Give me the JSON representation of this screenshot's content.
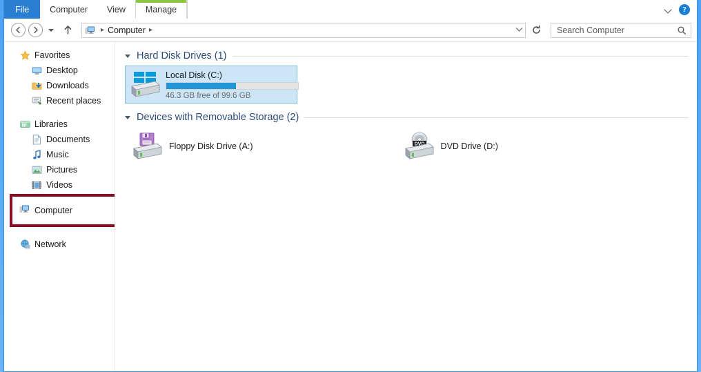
{
  "window": {
    "tabs": [
      {
        "label": "File",
        "kind": "file",
        "active": false
      },
      {
        "label": "Computer",
        "kind": "normal",
        "active": false
      },
      {
        "label": "View",
        "kind": "normal",
        "active": false
      },
      {
        "label": "Manage",
        "kind": "contextual",
        "active": true
      }
    ],
    "ribbon_collapse_icon": "chevron-down-icon",
    "help_icon": "help-icon",
    "help_label": "?"
  },
  "navbar": {
    "back_icon": "back-arrow-icon",
    "forward_icon": "forward-arrow-icon",
    "recent_icon": "recent-locations-icon",
    "up_icon": "up-arrow-icon",
    "breadcrumb_icon": "computer-icon",
    "breadcrumb": [
      "Computer"
    ],
    "separator": "▸",
    "address_dropdown_icon": "chevron-down-icon",
    "refresh_icon": "refresh-icon",
    "search_placeholder": "Search Computer",
    "search_value": "",
    "search_icon": "search-icon"
  },
  "sidebar": {
    "groups": [
      {
        "label": "Favorites",
        "icon": "star-icon",
        "items": [
          {
            "label": "Desktop",
            "icon": "desktop-icon"
          },
          {
            "label": "Downloads",
            "icon": "downloads-icon"
          },
          {
            "label": "Recent places",
            "icon": "recent-places-icon"
          }
        ]
      },
      {
        "label": "Libraries",
        "icon": "libraries-icon",
        "items": [
          {
            "label": "Documents",
            "icon": "documents-icon"
          },
          {
            "label": "Music",
            "icon": "music-icon"
          },
          {
            "label": "Pictures",
            "icon": "pictures-icon"
          },
          {
            "label": "Videos",
            "icon": "videos-icon"
          }
        ]
      }
    ],
    "computer": {
      "label": "Computer",
      "icon": "computer-icon",
      "highlighted": true
    },
    "network": {
      "label": "Network",
      "icon": "network-icon"
    },
    "highlight_color": "#8c0d22"
  },
  "content": {
    "groups": [
      {
        "title": "Hard Disk Drives (1)",
        "expanded": true,
        "items": [
          {
            "name": "Local Disk (C:)",
            "icon": "hard-disk-icon",
            "selected": true,
            "usage_text": "46.3 GB free of 99.6 GB",
            "free_gb": 46.3,
            "total_gb": 99.6,
            "used_percent": 53,
            "bar_fill_color": "#2196d9",
            "bar_track_color": "#e4e4e4"
          }
        ]
      },
      {
        "title": "Devices with Removable Storage (2)",
        "expanded": true,
        "items": [
          {
            "name": "Floppy Disk Drive (A:)",
            "icon": "floppy-drive-icon",
            "selected": false
          },
          {
            "name": "DVD Drive (D:)",
            "icon": "dvd-drive-icon",
            "selected": false
          }
        ]
      }
    ]
  }
}
